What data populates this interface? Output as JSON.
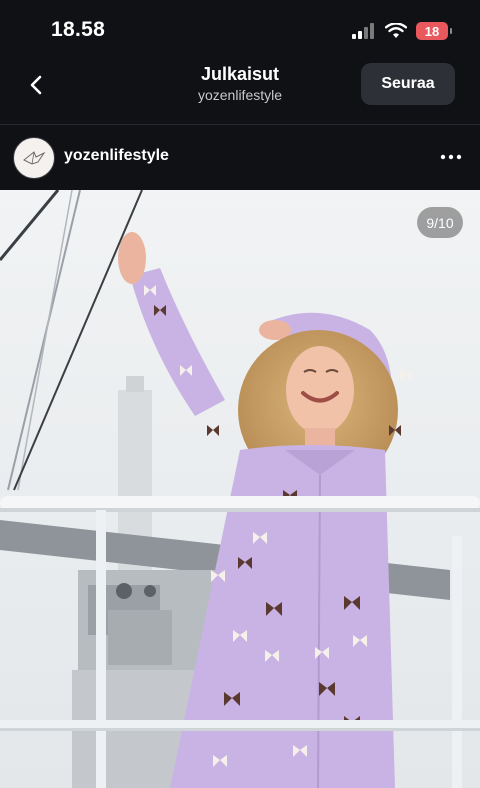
{
  "status_bar": {
    "time": "18.58",
    "battery_level": "18",
    "icons": [
      "cellular-signal-icon",
      "wifi-icon",
      "battery-icon"
    ]
  },
  "nav": {
    "title": "Julkaisut",
    "subtitle": "yozenlifestyle",
    "follow_label": "Seuraa",
    "back_icon": "chevron-left-icon"
  },
  "post": {
    "username": "yozenlifestyle",
    "more_icon": "more-horizontal-icon",
    "counter": "9/10"
  },
  "colors": {
    "background": "#0f1115",
    "button": "#2d3137",
    "battery": "#e8585c",
    "dress": "#c9b3e4"
  }
}
